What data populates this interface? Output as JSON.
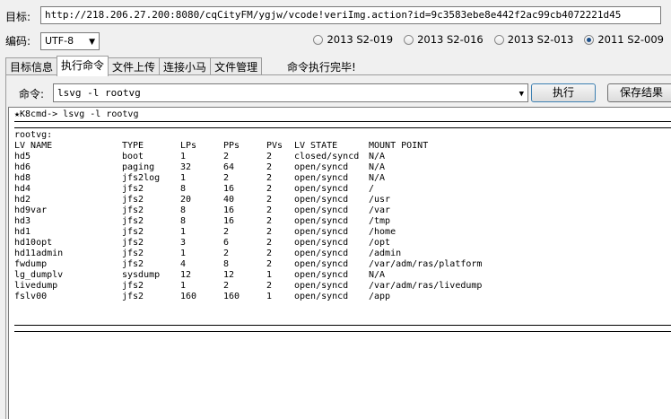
{
  "target": {
    "label": "目标:",
    "url": "http://218.206.27.200:8080/cqCityFM/ygjw/vcode!veriImg.action?id=9c3583ebe8e442f2ac99cb4072221d45"
  },
  "encoding": {
    "label": "编码:",
    "value": "UTF-8"
  },
  "versions": [
    {
      "label": "2013 S2-019",
      "selected": false
    },
    {
      "label": "2013 S2-016",
      "selected": false
    },
    {
      "label": "2013 S2-013",
      "selected": false
    },
    {
      "label": "2011 S2-009",
      "selected": true
    }
  ],
  "tabs": [
    {
      "label": "目标信息",
      "active": false
    },
    {
      "label": "执行命令",
      "active": true
    },
    {
      "label": "文件上传",
      "active": false
    },
    {
      "label": "连接小马",
      "active": false
    },
    {
      "label": "文件管理",
      "active": false
    }
  ],
  "status": "命令执行完毕!",
  "command": {
    "label": "命令:",
    "value": "lsvg -l rootvg",
    "exec_label": "执行",
    "save_label": "保存结果"
  },
  "output": {
    "prompt": "★K8cmd-> lsvg -l rootvg",
    "vg_name": "rootvg:",
    "headers": [
      "LV NAME",
      "TYPE",
      "LPs",
      "PPs",
      "PVs",
      "LV STATE",
      "MOUNT POINT"
    ],
    "rows": [
      [
        "hd5",
        "boot",
        "1",
        "2",
        "2",
        "closed/syncd",
        "N/A"
      ],
      [
        "hd6",
        "paging",
        "32",
        "64",
        "2",
        "open/syncd",
        "N/A"
      ],
      [
        "hd8",
        "jfs2log",
        "1",
        "2",
        "2",
        "open/syncd",
        "N/A"
      ],
      [
        "hd4",
        "jfs2",
        "8",
        "16",
        "2",
        "open/syncd",
        "/"
      ],
      [
        "hd2",
        "jfs2",
        "20",
        "40",
        "2",
        "open/syncd",
        "/usr"
      ],
      [
        "hd9var",
        "jfs2",
        "8",
        "16",
        "2",
        "open/syncd",
        "/var"
      ],
      [
        "hd3",
        "jfs2",
        "8",
        "16",
        "2",
        "open/syncd",
        "/tmp"
      ],
      [
        "hd1",
        "jfs2",
        "1",
        "2",
        "2",
        "open/syncd",
        "/home"
      ],
      [
        "hd10opt",
        "jfs2",
        "3",
        "6",
        "2",
        "open/syncd",
        "/opt"
      ],
      [
        "hd11admin",
        "jfs2",
        "1",
        "2",
        "2",
        "open/syncd",
        "/admin"
      ],
      [
        "fwdump",
        "jfs2",
        "4",
        "8",
        "2",
        "open/syncd",
        "/var/adm/ras/platform"
      ],
      [
        "lg_dumplv",
        "sysdump",
        "12",
        "12",
        "1",
        "open/syncd",
        "N/A"
      ],
      [
        "livedump",
        "jfs2",
        "1",
        "2",
        "2",
        "open/syncd",
        "/var/adm/ras/livedump"
      ],
      [
        "fslv00",
        "jfs2",
        "160",
        "160",
        "1",
        "open/syncd",
        "/app"
      ]
    ]
  }
}
